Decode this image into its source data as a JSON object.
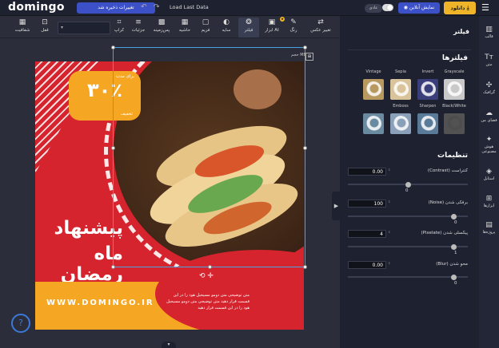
{
  "topbar": {
    "logo": "domingo",
    "save_status": "تغییرات ذخیره شد",
    "load_last": "Load Last Data",
    "mode_label": "عادی",
    "preview": "نمایش آنلاین",
    "download": "دانلود"
  },
  "toolbar": {
    "items": [
      {
        "label": "تغییر عکس",
        "icon": "swap-image-icon"
      },
      {
        "label": "رنگ",
        "icon": "palette-icon"
      },
      {
        "label": "ابزار AI",
        "icon": "ai-tools-icon"
      },
      {
        "label": "فیلتر",
        "icon": "filter-icon"
      },
      {
        "label": "سایه",
        "icon": "shadow-icon"
      },
      {
        "label": "فریم",
        "icon": "frame-icon"
      },
      {
        "label": "حاشیه",
        "icon": "border-icon"
      },
      {
        "label": "پس‌زمینه",
        "icon": "background-icon"
      },
      {
        "label": "جزئیات",
        "icon": "details-icon"
      },
      {
        "label": "کراپ",
        "icon": "crop-icon"
      },
      {
        "label": "قفل",
        "icon": "lock-icon"
      },
      {
        "label": "شفافیت",
        "icon": "transparency-icon"
      }
    ],
    "ai_badge": "★"
  },
  "canvas": {
    "size_label": "حجم MB"
  },
  "design": {
    "badge_top": "برای مدت",
    "badge_percent": "۳۰٪",
    "badge_bottom": "تخفیف",
    "headline_1": "پیشنهاد",
    "headline_2": "ماه رمضان",
    "url": "WWW.DOMINGO.IR",
    "description": "متن توضیحی متن دومو مسیحیل هود را در این قسمت قرار دهید متن توضیحی متن دومو مسیحیل هود را در این قسمت قرار دهید"
  },
  "selection_controls": "⟲ ✛",
  "help": "?",
  "panel": {
    "title": "فیلتر",
    "filters_title": "فیلترها",
    "filters": [
      {
        "label": "Grayscale",
        "color": "#c9c9c9"
      },
      {
        "label": "Invert",
        "color": "#3a3e7a"
      },
      {
        "label": "Sepia",
        "color": "#d9c39a"
      },
      {
        "label": "Vintage",
        "color": "#b89a60"
      },
      {
        "label": "Black/White",
        "color": "#f0f0f0"
      },
      {
        "label": "Sharpen",
        "color": "#5a7a9a"
      },
      {
        "label": "Emboss",
        "color": "#8aa0b8"
      },
      {
        "label": "",
        "color": "#6a8aa0"
      }
    ],
    "settings_title": "تنظیمات",
    "settings": [
      {
        "label": "کنتراست (Contrast)",
        "value": "0.00",
        "track": "0",
        "fraction": 0.5
      },
      {
        "label": "برفکی شدن (Noise)",
        "value": "100",
        "track": "0",
        "fraction": 0.88
      },
      {
        "label": "پیکسلی شدن (Pixelate)",
        "value": "4",
        "track": "1",
        "fraction": 0.88
      },
      {
        "label": "محو شدن (Blur)",
        "value": "0.00",
        "track": "0",
        "fraction": 0.88
      }
    ]
  },
  "sidebar": {
    "items": [
      {
        "label": "قالب",
        "icon": "template-icon"
      },
      {
        "label": "متن",
        "icon": "text-icon"
      },
      {
        "label": "گرافیک",
        "icon": "graphics-icon"
      },
      {
        "label": "فضای من",
        "icon": "cloud-icon"
      },
      {
        "label": "هوش مصنوعی",
        "icon": "ai-icon"
      },
      {
        "label": "استایل",
        "icon": "style-icon"
      },
      {
        "label": "ابزارها",
        "icon": "tools-icon"
      },
      {
        "label": "پروژه‌ها",
        "icon": "projects-icon"
      }
    ]
  },
  "colors": {
    "accent": "#3c50c8",
    "primary_red": "#d6242e",
    "orange": "#f5a623",
    "panel_bg": "#1e2130"
  }
}
